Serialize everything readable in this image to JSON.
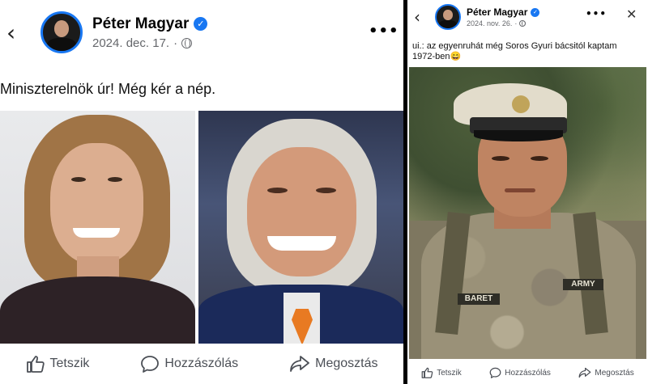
{
  "left_post": {
    "author": "Péter Magyar",
    "date": "2024. dec. 17.",
    "separator": "·",
    "text": "Miniszterelnök úr! Még kér a nép.",
    "actions": {
      "like": "Tetszik",
      "comment": "Hozzászólás",
      "share": "Megosztás"
    }
  },
  "right_post": {
    "author": "Péter Magyar",
    "date": "2024. nov. 26.",
    "separator": "·",
    "text": "ui.: az egyenruhát még Soros Gyuri bácsitól kaptam 1972-ben😄",
    "uniform_tape": "BARET",
    "uniform_branch": "ARMY",
    "actions": {
      "like": "Tetszik",
      "comment": "Hozzászólás",
      "share": "Megosztás"
    }
  },
  "colors": {
    "accent": "#1877f2",
    "text_primary": "#050505",
    "text_secondary": "#65676b"
  },
  "icons": [
    "back-icon",
    "verified-icon",
    "globe-icon",
    "more-icon",
    "close-icon",
    "like-icon",
    "comment-icon",
    "share-icon"
  ]
}
